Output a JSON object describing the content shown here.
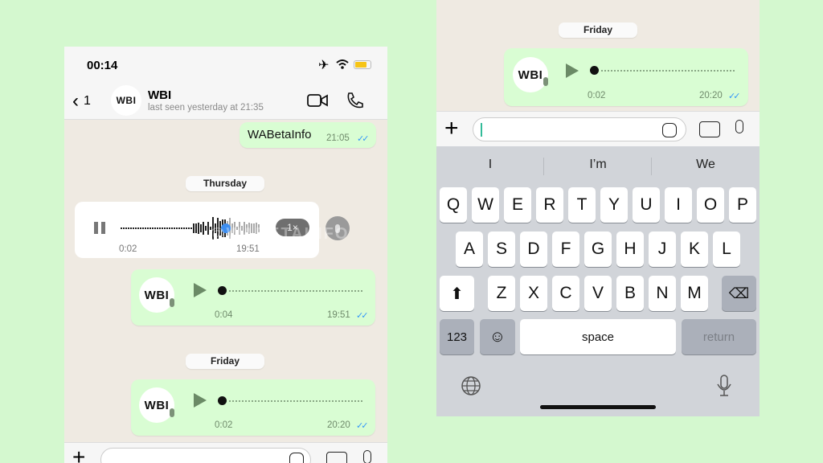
{
  "left_phone": {
    "status": {
      "time": "00:14",
      "icons": [
        "airplane-icon",
        "wifi-icon",
        "battery-icon"
      ],
      "battery_color": "#f6c416"
    },
    "header": {
      "back_count": "1",
      "avatar_text": "WBI",
      "name": "WBI",
      "subtitle": "last seen yesterday at 21:35"
    },
    "messages": [
      {
        "type": "text",
        "text": "WABetaInfo",
        "time": "21:05"
      },
      {
        "type": "date",
        "text": "Thursday"
      },
      {
        "type": "voice-playing",
        "elapsed": "0:02",
        "time": "19:51",
        "speed": "1×",
        "progress": 0.75
      },
      {
        "type": "voice",
        "avatar_text": "WBI",
        "duration": "0:04",
        "time": "19:51"
      },
      {
        "type": "date",
        "text": "Friday"
      },
      {
        "type": "voice",
        "avatar_text": "WBI",
        "duration": "0:02",
        "time": "20:20"
      }
    ],
    "watermark": "@WABETAINFO"
  },
  "right_phone": {
    "date": "Friday",
    "voice": {
      "avatar_text": "WBI",
      "duration": "0:02",
      "time": "20:20"
    },
    "input": {
      "value": ""
    },
    "suggestions": [
      "I",
      "I’m",
      "We"
    ],
    "keyboard": {
      "row1": [
        "Q",
        "W",
        "E",
        "R",
        "T",
        "Y",
        "U",
        "I",
        "O",
        "P"
      ],
      "row2": [
        "A",
        "S",
        "D",
        "F",
        "G",
        "H",
        "J",
        "K",
        "L"
      ],
      "row3": [
        "Z",
        "X",
        "C",
        "V",
        "B",
        "N",
        "M"
      ],
      "numbers": "123",
      "space": "space",
      "return": "return"
    }
  },
  "colors": {
    "background": "#d4f8cf",
    "bubble": "#d9fdd3",
    "chat_bg": "#efeae2",
    "read_tick": "#3497f9",
    "progress": "#3d8ef0"
  }
}
